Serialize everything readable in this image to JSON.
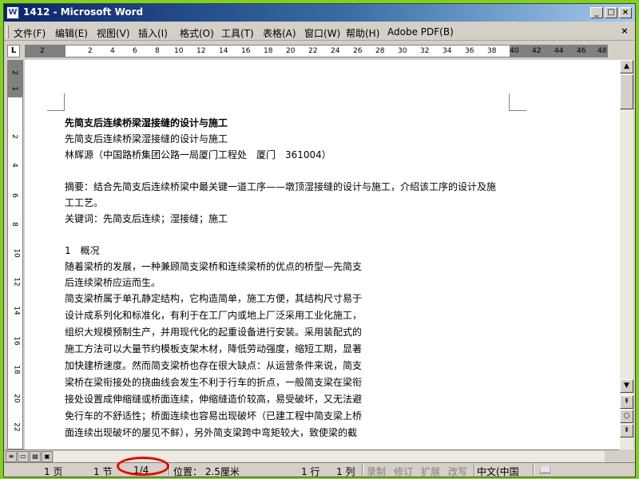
{
  "window": {
    "title": "1412 - Microsoft Word",
    "app_icon_letter": "W",
    "min_glyph": "_",
    "max_glyph": "□",
    "close_glyph": "×"
  },
  "menu": {
    "items": [
      "文件(F)",
      "编辑(E)",
      "视图(V)",
      "插入(I)",
      "格式(O)",
      "工具(T)",
      "表格(A)",
      "窗口(W)",
      "帮助(H)",
      "Adobe PDF(B)"
    ],
    "close_glyph": "×"
  },
  "ruler": {
    "tab_glyph": "L",
    "h_ticks": [
      "2",
      "2",
      "4",
      "6",
      "8",
      "10",
      "12",
      "14",
      "16",
      "18",
      "20",
      "22",
      "24",
      "26",
      "28",
      "30",
      "32",
      "34",
      "36",
      "38",
      "40",
      "42",
      "44",
      "46",
      "48"
    ],
    "v_ticks": [
      "2",
      "1",
      "2",
      "4",
      "6",
      "8",
      "10",
      "12",
      "14",
      "16",
      "18",
      "20",
      "22"
    ]
  },
  "document": {
    "lines": [
      "先简支后连续桥梁湿接缝的设计与施工",
      "先简支后连续桥梁湿接缝的设计与施工",
      "林辉源（中国路桥集团公路一局厦门工程处　厦门　361004）",
      "",
      "摘要：结合先简支后连续桥梁中最关键一道工序——墩顶湿接缝的设计与施工，介绍该工序的设计及施",
      "工工艺。",
      "关键词：先简支后连续；湿接缝；施工",
      "",
      "1　概况",
      "随着梁桥的发展，一种兼顾简支梁桥和连续梁桥的优点的桥型—先简支",
      "后连续梁桥应运而生。",
      "简支梁桥属于单孔静定结构，它构造简单，施工方便，其结构尺寸易于",
      "设计成系列化和标准化，有利于在工厂内或地上厂泛采用工业化施工，",
      "组织大规模预制生产，并用现代化的起重设备进行安装。采用装配式的",
      "施工方法可以大量节约模板支架木材，降低劳动强度，缩短工期，显著",
      "加快建桥速度。然而简支梁桥也存在很大缺点：从运营条件来说，简支",
      "梁桥在梁衔接处的挠曲线会发生不利于行车的折点，一般简支梁在梁衔",
      "接处设置成伸缩缝或桥面连续，伸缩缝造价较高，易受破坏，又无法避",
      "免行车的不舒适性；桥面连续也容易出现破坏（已建工程中简支梁上桥",
      "面连续出现破坏的屡见不鲜），另外简支梁跨中弯矩较大，致使梁的截"
    ]
  },
  "scroll": {
    "up": "▲",
    "down": "▼",
    "prev_page": "⇞",
    "browse": "○",
    "next_page": "⇟"
  },
  "view_buttons": [
    "≡",
    "▭",
    "▤",
    "▣"
  ],
  "status": {
    "page": "1 页",
    "section": "1 节",
    "page_of": "1/4",
    "position": "位置： 2.5厘米",
    "line": "1 行",
    "col": "1 列",
    "rec": "录制",
    "trk": "修订",
    "ext": "扩展",
    "ovr": "改写",
    "language": "中文(中国",
    "spell_icon": "📖"
  },
  "annotation": {
    "highlight_color": "#e80000"
  }
}
